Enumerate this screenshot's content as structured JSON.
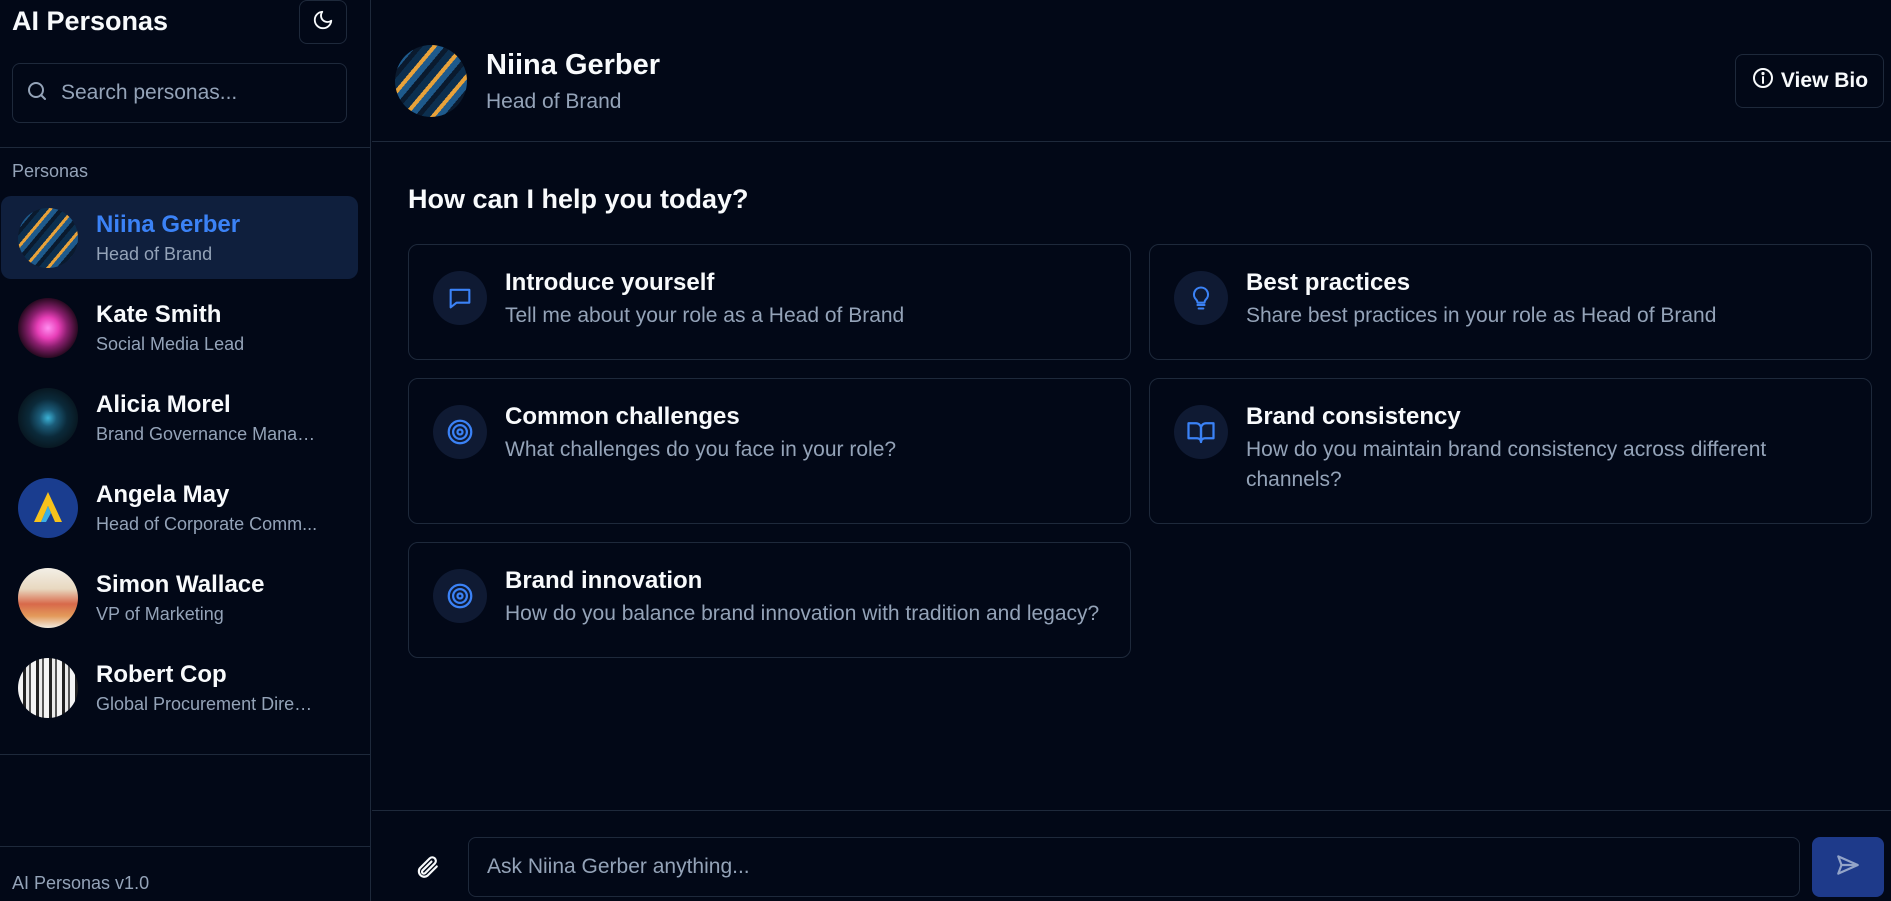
{
  "app": {
    "title": "AI Personas",
    "version": "AI Personas v1.0"
  },
  "search": {
    "placeholder": "Search personas..."
  },
  "sidebar": {
    "section_label": "Personas",
    "personas": [
      {
        "name": "Niina Gerber",
        "role": "Head of Brand",
        "active": true
      },
      {
        "name": "Kate Smith",
        "role": "Social Media Lead",
        "active": false
      },
      {
        "name": "Alicia Morel",
        "role": "Brand Governance Manager",
        "active": false
      },
      {
        "name": "Angela May",
        "role": "Head of Corporate Comm...",
        "active": false
      },
      {
        "name": "Simon Wallace",
        "role": "VP of Marketing",
        "active": false
      },
      {
        "name": "Robert Cop",
        "role": "Global Procurement Direct...",
        "active": false
      }
    ]
  },
  "header": {
    "name": "Niina Gerber",
    "role": "Head of Brand",
    "view_bio_label": "View Bio"
  },
  "main": {
    "greeting": "How can I help you today?",
    "suggestions": [
      {
        "icon": "message-square-icon",
        "title": "Introduce yourself",
        "description": "Tell me about your role as a Head of Brand"
      },
      {
        "icon": "lightbulb-icon",
        "title": "Best practices",
        "description": "Share best practices in your role as Head of Brand"
      },
      {
        "icon": "target-icon",
        "title": "Common challenges",
        "description": "What challenges do you face in your role?"
      },
      {
        "icon": "book-open-icon",
        "title": "Brand consistency",
        "description": "How do you maintain brand consistency across different channels?"
      },
      {
        "icon": "target-icon",
        "title": "Brand innovation",
        "description": "How do you balance brand innovation with tradition and legacy?"
      }
    ]
  },
  "composer": {
    "placeholder": "Ask Niina Gerber anything..."
  },
  "colors": {
    "background": "#020817",
    "accent": "#3b82f6",
    "muted_text": "#94a3b8",
    "border": "#1e293b",
    "send_button": "#1e3a8a"
  }
}
